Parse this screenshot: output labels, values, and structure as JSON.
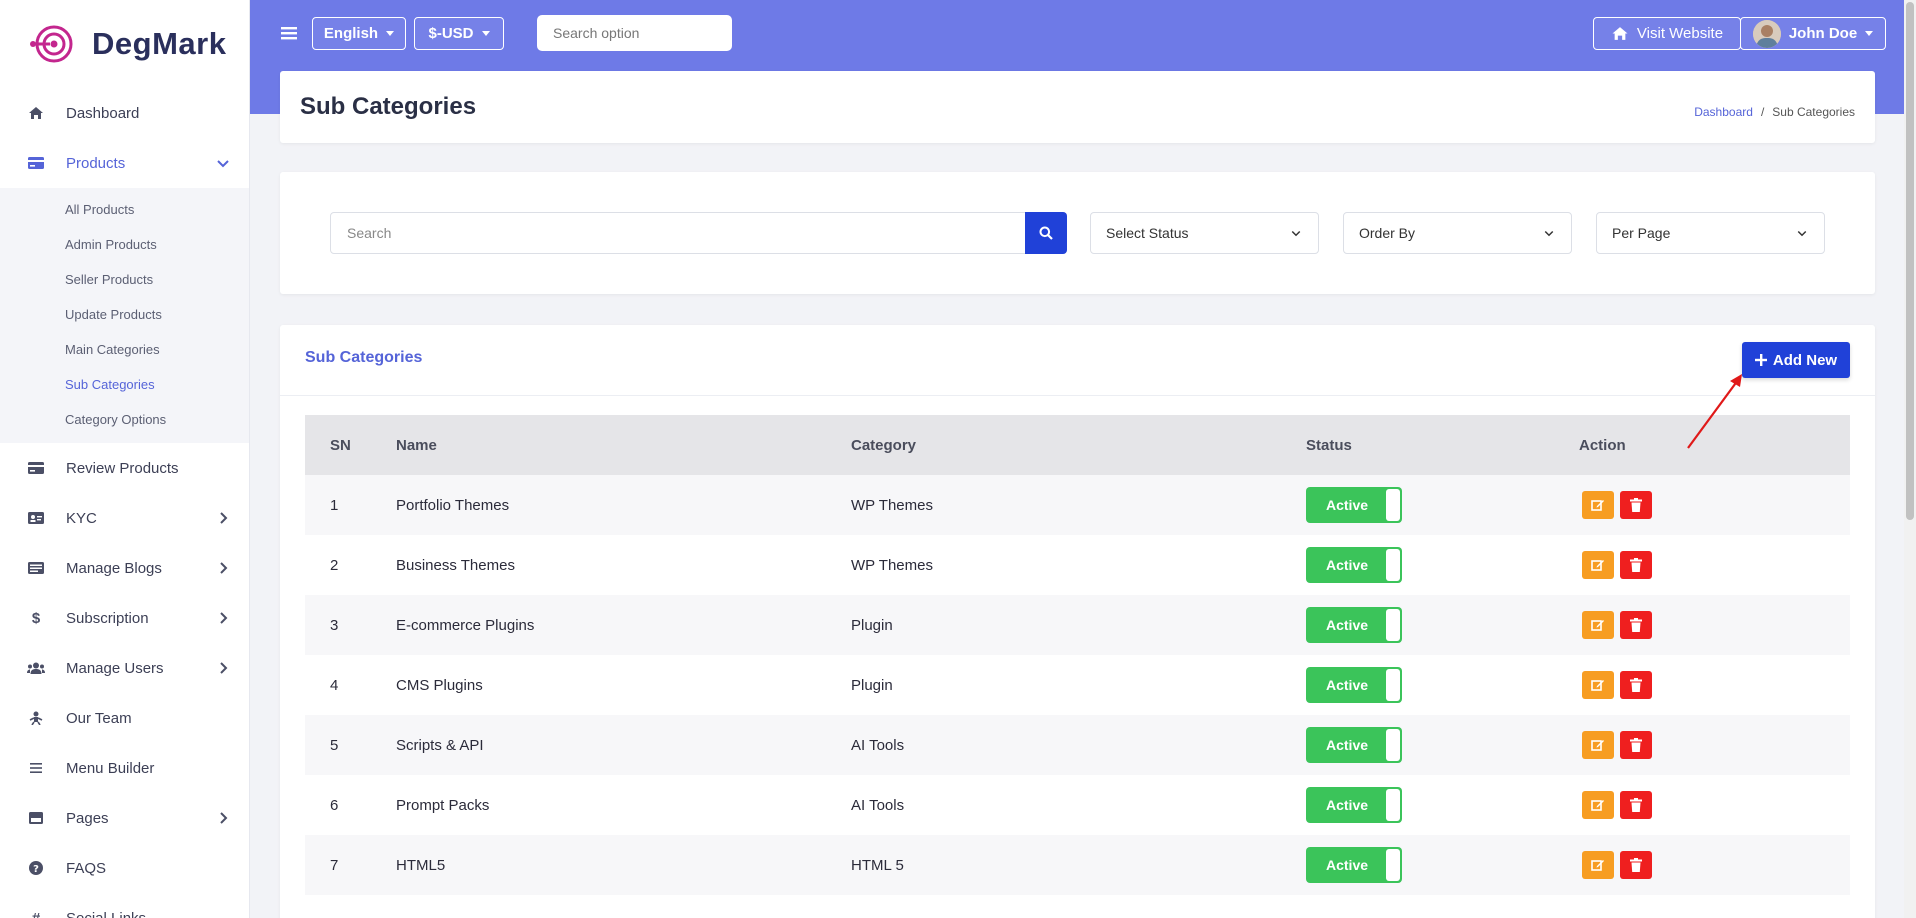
{
  "brand": {
    "name": "DegMark"
  },
  "colors": {
    "primary": "#6e7ae7",
    "accent": "#2041d8",
    "success": "#3bc45a",
    "warning": "#f79d22",
    "danger": "#ef1f1f"
  },
  "sidebar": {
    "items": [
      {
        "label": "Dashboard",
        "icon": "home-icon"
      },
      {
        "label": "Products",
        "icon": "credit-card-icon",
        "expanded": true,
        "sub": [
          "All Products",
          "Admin Products",
          "Seller Products",
          "Update Products",
          "Main Categories",
          "Sub Categories",
          "Category Options"
        ]
      },
      {
        "label": "Review Products",
        "icon": "credit-card-icon"
      },
      {
        "label": "KYC",
        "icon": "id-card-icon"
      },
      {
        "label": "Manage Blogs",
        "icon": "newspaper-icon"
      },
      {
        "label": "Subscription",
        "icon": "dollar-icon"
      },
      {
        "label": "Manage Users",
        "icon": "users-icon"
      },
      {
        "label": "Our Team",
        "icon": "team-icon"
      },
      {
        "label": "Menu Builder",
        "icon": "bars-icon"
      },
      {
        "label": "Pages",
        "icon": "page-icon"
      },
      {
        "label": "FAQS",
        "icon": "question-icon"
      },
      {
        "label": "Social Links",
        "icon": "hashtag-icon"
      }
    ]
  },
  "topbar": {
    "language": "English",
    "currency": "$-USD",
    "search_placeholder": "Search option",
    "visit_website": "Visit Website",
    "user_name": "John Doe"
  },
  "page": {
    "title": "Sub Categories",
    "breadcrumb": [
      "Dashboard",
      "Sub Categories"
    ]
  },
  "filters": {
    "search_placeholder": "Search",
    "status": "Select Status",
    "order_by": "Order By",
    "per_page": "Per Page"
  },
  "table": {
    "title": "Sub Categories",
    "add_label": "Add New",
    "headers": [
      "SN",
      "Name",
      "Category",
      "Status",
      "Action"
    ],
    "rows": [
      {
        "sn": "1",
        "name": "Portfolio Themes",
        "category": "WP Themes",
        "status": "Active"
      },
      {
        "sn": "2",
        "name": "Business Themes",
        "category": "WP Themes",
        "status": "Active"
      },
      {
        "sn": "3",
        "name": "E-commerce Plugins",
        "category": "Plugin",
        "status": "Active"
      },
      {
        "sn": "4",
        "name": "CMS Plugins",
        "category": "Plugin",
        "status": "Active"
      },
      {
        "sn": "5",
        "name": "Scripts & API",
        "category": "AI Tools",
        "status": "Active"
      },
      {
        "sn": "6",
        "name": "Prompt Packs",
        "category": "AI Tools",
        "status": "Active"
      },
      {
        "sn": "7",
        "name": "HTML5",
        "category": "HTML 5",
        "status": "Active"
      }
    ]
  }
}
